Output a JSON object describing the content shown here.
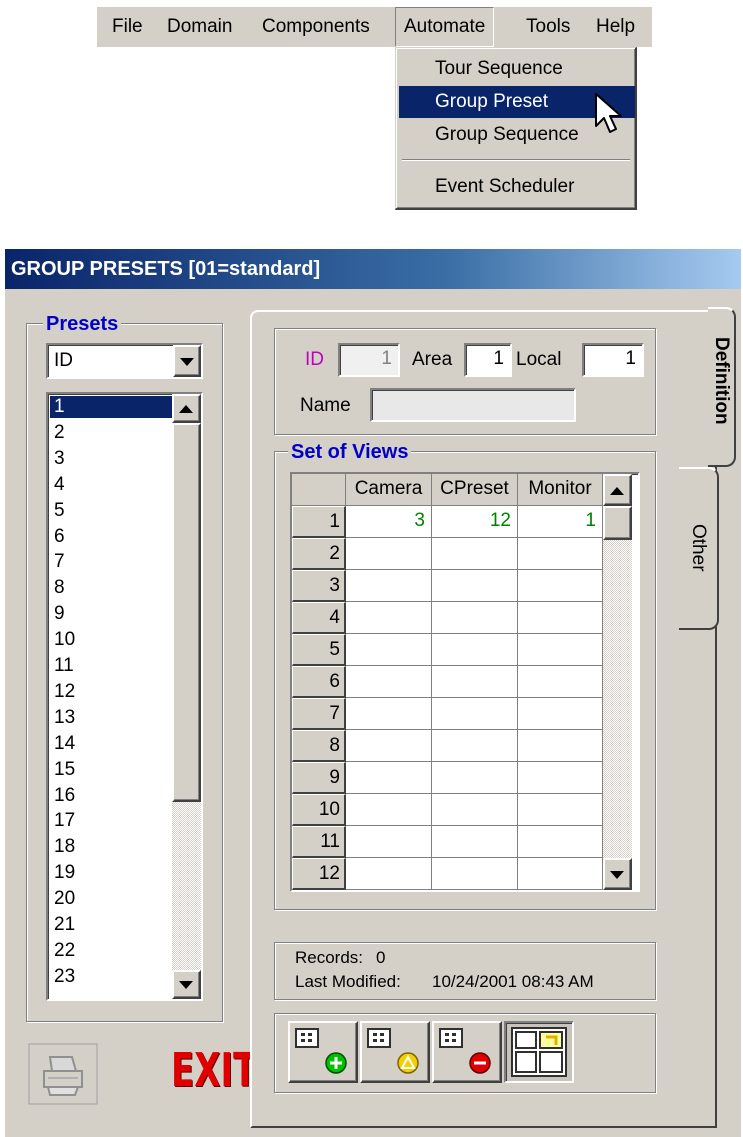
{
  "menu": {
    "items": [
      "File",
      "Domain",
      "Components",
      "Automate",
      "Tools",
      "Help"
    ],
    "open_menu": "Automate",
    "dropdown": [
      "Tour Sequence",
      "Group Preset",
      "Group Sequence",
      "Event Scheduler"
    ],
    "highlighted": "Group Preset"
  },
  "window": {
    "title": "GROUP PRESETS  [01=standard]"
  },
  "presets": {
    "group_label": "Presets",
    "sort_by": "ID",
    "items": [
      "1",
      "2",
      "3",
      "4",
      "5",
      "6",
      "7",
      "8",
      "9",
      "10",
      "11",
      "12",
      "13",
      "14",
      "15",
      "16",
      "17",
      "18",
      "19",
      "20",
      "21",
      "22",
      "23"
    ],
    "selected": "1"
  },
  "tabs": {
    "definition": "Definition",
    "other": "Other"
  },
  "definition": {
    "id_label": "ID",
    "id_value": "1",
    "area_label": "Area",
    "area_value": "1",
    "local_label": "Local",
    "local_value": "1",
    "name_label": "Name",
    "name_value": ""
  },
  "views": {
    "group_label": "Set of Views",
    "columns": [
      "Camera",
      "CPreset",
      "Monitor"
    ],
    "rows": [
      {
        "n": "1",
        "camera": "3",
        "cpreset": "12",
        "monitor": "1"
      },
      {
        "n": "2",
        "camera": "",
        "cpreset": "",
        "monitor": ""
      },
      {
        "n": "3",
        "camera": "",
        "cpreset": "",
        "monitor": ""
      },
      {
        "n": "4",
        "camera": "",
        "cpreset": "",
        "monitor": ""
      },
      {
        "n": "5",
        "camera": "",
        "cpreset": "",
        "monitor": ""
      },
      {
        "n": "6",
        "camera": "",
        "cpreset": "",
        "monitor": ""
      },
      {
        "n": "7",
        "camera": "",
        "cpreset": "",
        "monitor": ""
      },
      {
        "n": "8",
        "camera": "",
        "cpreset": "",
        "monitor": ""
      },
      {
        "n": "9",
        "camera": "",
        "cpreset": "",
        "monitor": ""
      },
      {
        "n": "10",
        "camera": "",
        "cpreset": "",
        "monitor": ""
      },
      {
        "n": "11",
        "camera": "",
        "cpreset": "",
        "monitor": ""
      },
      {
        "n": "12",
        "camera": "",
        "cpreset": "",
        "monitor": ""
      }
    ]
  },
  "status": {
    "records_label": "Records:",
    "records_value": "0",
    "modified_label": "Last Modified:",
    "modified_value": "10/24/2001 08:43 AM"
  },
  "buttons": {
    "exit_label": "EXIT",
    "print_icon": "printer-icon",
    "add_icon": "add-record-icon",
    "edit_icon": "edit-record-icon",
    "delete_icon": "delete-record-icon",
    "view_icon": "layout-view-icon"
  },
  "colors": {
    "title_start": "#0a246a",
    "title_end": "#a6caf0",
    "group_label": "#0000c8",
    "id_label": "#c000c0",
    "grid_value": "#008000",
    "exit": "#e00000"
  }
}
